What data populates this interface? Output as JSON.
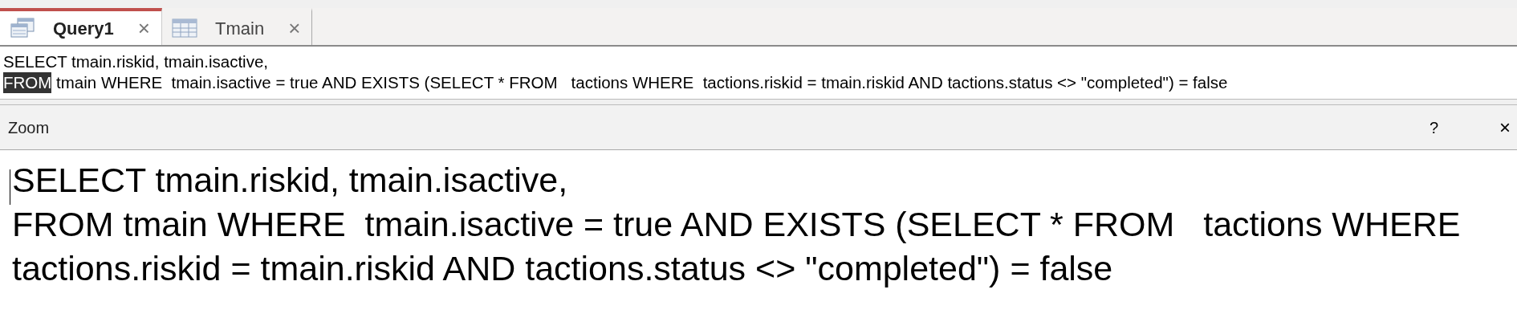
{
  "tabs": [
    {
      "label": "Query1",
      "kind": "query",
      "selected": true,
      "close": "×"
    },
    {
      "label": "Tmain",
      "kind": "table",
      "selected": false,
      "close": "×"
    }
  ],
  "sql_editor": {
    "lines": [
      [
        {
          "text": "SELECT tmain.riskid, tmain.isactive,",
          "selected": false
        }
      ],
      [
        {
          "text": "FROM",
          "selected": true
        },
        {
          "text": " tmain WHERE  tmain.isactive = true AND EXISTS (SELECT * FROM   tactions WHERE  tactions.riskid = tmain.riskid AND tactions.status <> \"completed\") = false",
          "selected": false
        }
      ]
    ]
  },
  "zoom_dialog": {
    "title": "Zoom",
    "help": "?",
    "close": "×",
    "lines": [
      "SELECT tmain.riskid, tmain.isactive,",
      "FROM tmain WHERE  tmain.isactive = true AND EXISTS (SELECT * FROM   tactions WHERE",
      "tactions.riskid = tmain.riskid AND tactions.status <> \"completed\") = false"
    ]
  }
}
